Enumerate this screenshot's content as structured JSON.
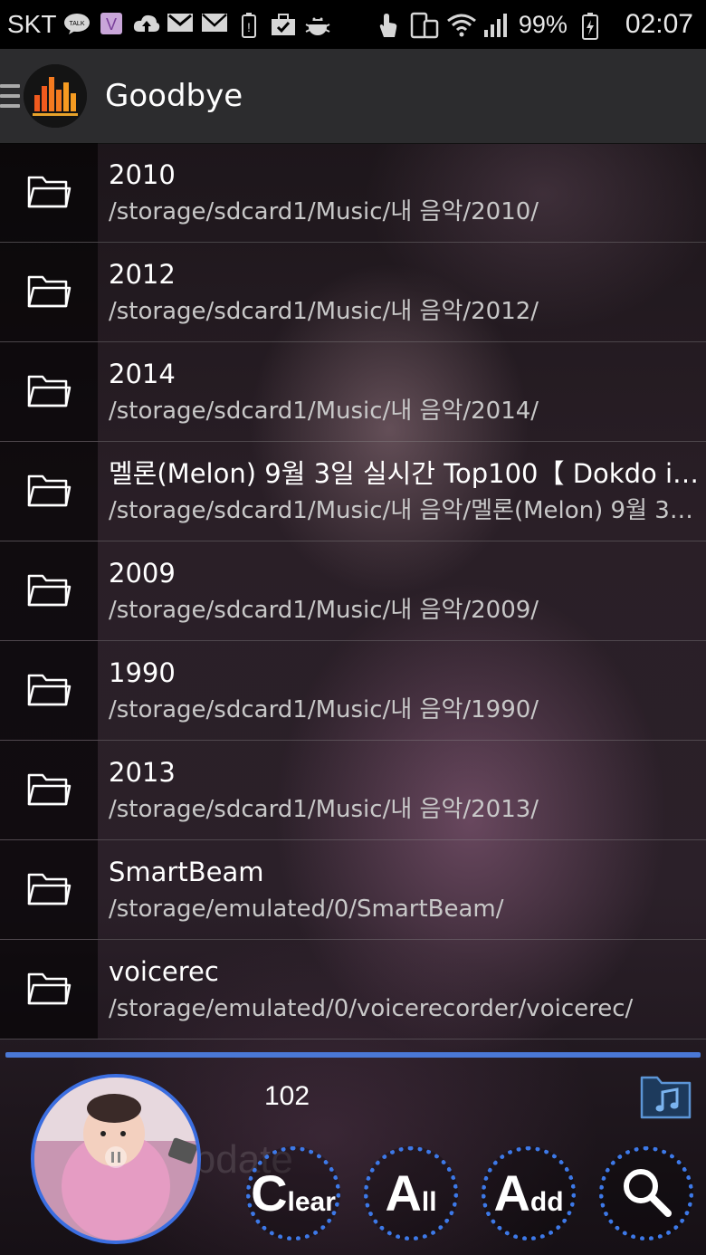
{
  "status_bar": {
    "carrier": "SKT",
    "battery_percent": "99%",
    "time": "02:07",
    "icons_left": [
      "talk-icon",
      "viber-icon",
      "upload-icon",
      "gmail-icon",
      "mail-icon",
      "battery-saver-icon",
      "clipboard-icon",
      "android-debug-icon"
    ],
    "icons_right": [
      "touch-icon",
      "device-icon",
      "wifi-icon",
      "signal-icon",
      "battery-icon"
    ]
  },
  "action_bar": {
    "title": "Goodbye"
  },
  "folders": [
    {
      "name": "2010",
      "path": "/storage/sdcard1/Music/내 음악/2010/"
    },
    {
      "name": "2012",
      "path": "/storage/sdcard1/Music/내 음악/2012/"
    },
    {
      "name": "2014",
      "path": "/storage/sdcard1/Music/내 음악/2014/"
    },
    {
      "name": "멜론(Melon) 9월 3일 실시간 Top100【 Dokdo i…",
      "path": "/storage/sdcard1/Music/내 음악/멜론(Melon) 9월 3…"
    },
    {
      "name": "2009",
      "path": "/storage/sdcard1/Music/내 음악/2009/"
    },
    {
      "name": "1990",
      "path": "/storage/sdcard1/Music/내 음악/1990/"
    },
    {
      "name": "2013",
      "path": "/storage/sdcard1/Music/내 음악/2013/"
    },
    {
      "name": "SmartBeam",
      "path": "/storage/emulated/0/SmartBeam/"
    },
    {
      "name": "voicerec",
      "path": "/storage/emulated/0/voicerecorder/voicerec/"
    }
  ],
  "player": {
    "track_count": "102",
    "watermark": "Update",
    "buttons": {
      "clear": {
        "big": "C",
        "small": "lear"
      },
      "all": {
        "big": "A",
        "small": "ll"
      },
      "add": {
        "big": "A",
        "small": "dd"
      }
    }
  },
  "colors": {
    "accent": "#3d79e8",
    "actionbar_bg": "#2c2c2e"
  }
}
